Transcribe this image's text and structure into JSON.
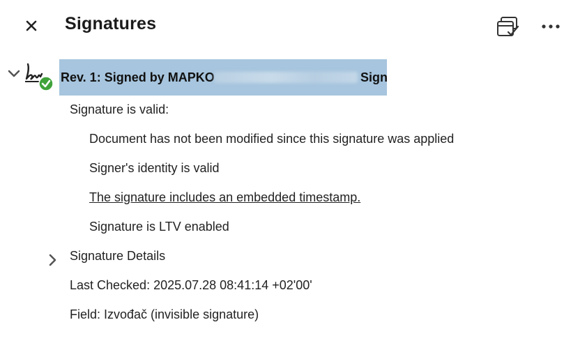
{
  "header": {
    "title": "Signatures",
    "close_icon": "close-icon",
    "validate_icon": "validate-all-icon",
    "more_icon": "more-options-icon"
  },
  "revision": {
    "label": "Rev. 1: Signed by MAPKO",
    "suffix": "Sign",
    "status_color": "#3fa33a",
    "highlight_color": "#a7c5de"
  },
  "status": {
    "heading": "Signature is valid:",
    "items": [
      "Document has not been modified since this signature was applied",
      "Signer's identity is valid",
      "The signature includes an embedded timestamp.",
      "Signature is LTV enabled"
    ]
  },
  "details": {
    "label": "Signature Details",
    "last_checked": "Last Checked: 2025.07.28 08:41:14 +02'00'",
    "field": "Field: Izvođač (invisible signature)"
  }
}
